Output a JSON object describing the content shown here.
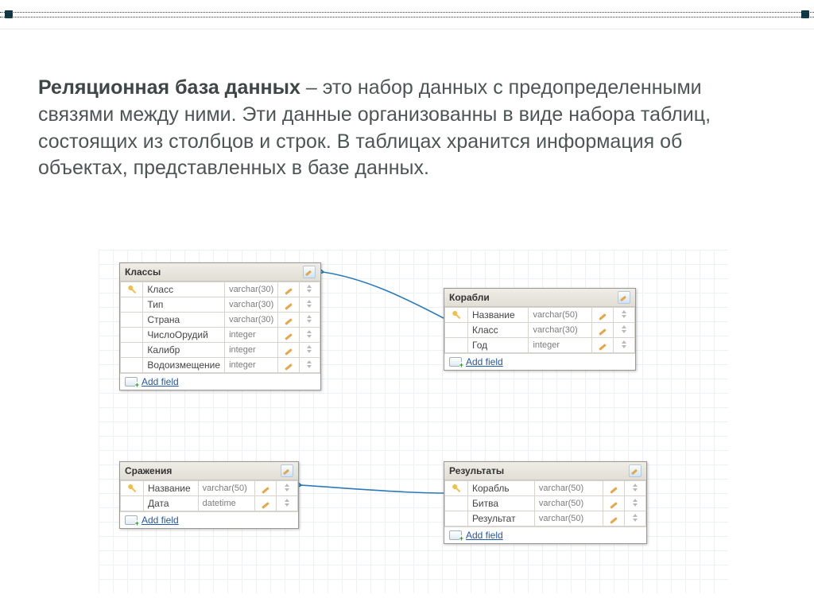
{
  "text": {
    "title_bold": "Реляционная база данных",
    "definition_rest": " – это набор данных с предопределенными связями между ними. Эти данные организованны в виде набора таблиц, состоящих из столбцов и строк. В таблицах хранится информация об объектах, представленных в базе данных."
  },
  "ui": {
    "add_field": "Add field"
  },
  "tables": {
    "klassy": {
      "title": "Классы",
      "fields": [
        {
          "key": true,
          "name": "Класс",
          "type": "varchar(30)"
        },
        {
          "key": false,
          "name": "Тип",
          "type": "varchar(30)"
        },
        {
          "key": false,
          "name": "Страна",
          "type": "varchar(30)"
        },
        {
          "key": false,
          "name": "ЧислоОрудий",
          "type": "integer"
        },
        {
          "key": false,
          "name": "Калибр",
          "type": "integer"
        },
        {
          "key": false,
          "name": "Водоизмещение",
          "type": "integer"
        }
      ]
    },
    "korabli": {
      "title": "Корабли",
      "fields": [
        {
          "key": true,
          "name": "Название",
          "type": "varchar(50)"
        },
        {
          "key": false,
          "name": "Класс",
          "type": "varchar(30)"
        },
        {
          "key": false,
          "name": "Год",
          "type": "integer"
        }
      ]
    },
    "srazheniya": {
      "title": "Сражения",
      "fields": [
        {
          "key": true,
          "name": "Название",
          "type": "varchar(50)"
        },
        {
          "key": false,
          "name": "Дата",
          "type": "datetime"
        }
      ]
    },
    "rezultaty": {
      "title": "Результаты",
      "fields": [
        {
          "key": true,
          "name": "Корабль",
          "type": "varchar(50)"
        },
        {
          "key": false,
          "name": "Битва",
          "type": "varchar(50)"
        },
        {
          "key": false,
          "name": "Результат",
          "type": "varchar(50)"
        }
      ]
    }
  },
  "relations": [
    {
      "from": "korabli",
      "to": "klassy"
    },
    {
      "from": "rezultaty",
      "to": "srazheniya"
    }
  ]
}
